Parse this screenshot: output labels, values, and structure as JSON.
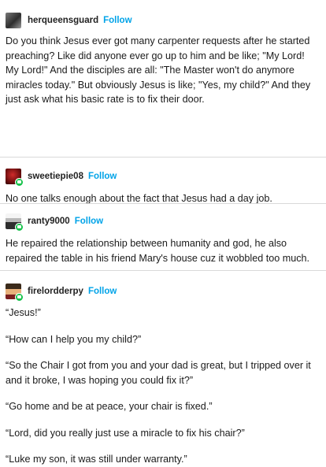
{
  "posts": [
    {
      "username": "herqueensguard",
      "avatar_icon": "blurred-figure-avatar",
      "follow_label": "Follow",
      "paragraphs": [
        "Do you think Jesus ever got many carpenter requests after he started preaching? Like did anyone ever go up to him and be like; \"My Lord! My Lord!\" And the disciples are all: \"The Master won't do anymore miracles today.\" But obviously Jesus is like; \"Yes, my child?\" And they just ask what his basic rate is to fix their door."
      ]
    },
    {
      "username": "sweetiepie08",
      "avatar_icon": "red-abstract-avatar",
      "follow_label": "Follow",
      "paragraphs": [
        "No one talks enough about the fact that Jesus had a day job."
      ]
    },
    {
      "username": "ranty9000",
      "avatar_icon": "pixel-character-avatar",
      "follow_label": "Follow",
      "paragraphs": [
        "He repaired the relationship between humanity and god, he also repaired the table in his friend Mary's house cuz it wobbled too much."
      ]
    },
    {
      "username": "firelordderpy",
      "avatar_icon": "pixel-character-avatar",
      "follow_label": "Follow",
      "paragraphs": [
        "“Jesus!”",
        "“How can I help you my child?”",
        "“So the Chair I got from you and your dad is great, but I tripped over it and it broke, I was hoping you could fix it?”",
        "“Go home and be at peace, your chair is fixed.”",
        "“Lord, did you really just use a miracle to fix his chair?”",
        "“Luke my son, it was still under warranty.”"
      ]
    }
  ],
  "colors": {
    "follow": "#00a3e8",
    "badge": "#16c24a",
    "divider": "#d9d9d9",
    "text": "#1a1a1a"
  }
}
